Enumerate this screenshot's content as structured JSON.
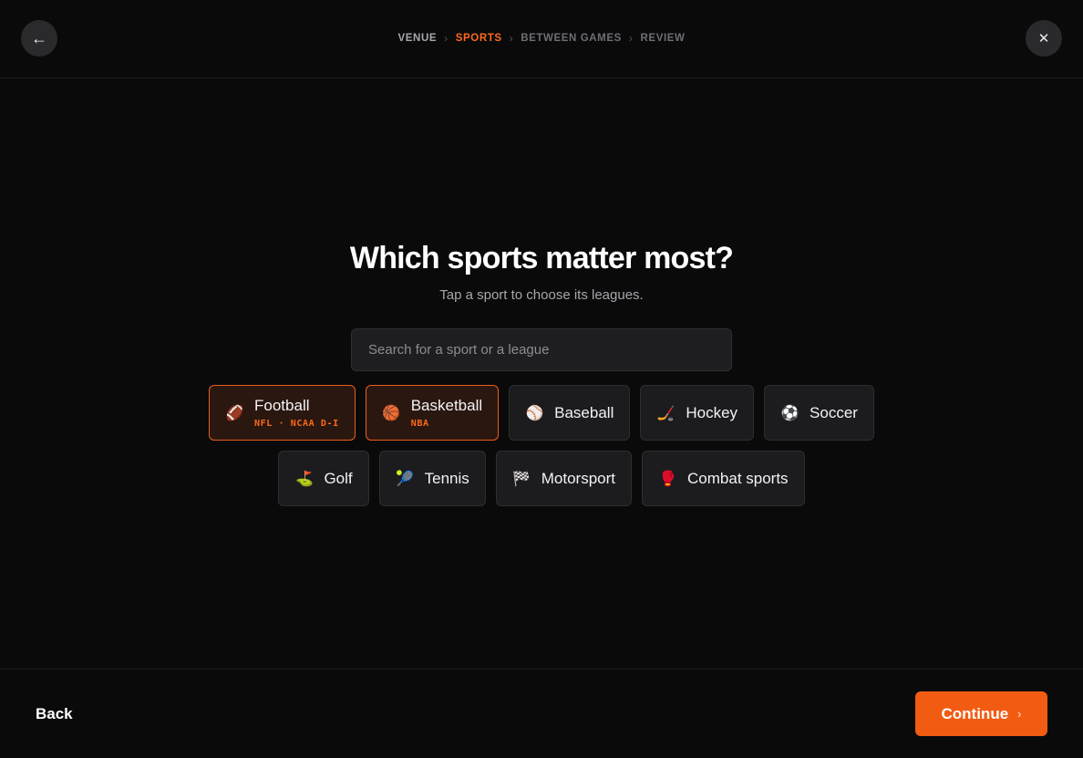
{
  "header": {
    "back_icon": "←",
    "close_icon": "✕",
    "steps": [
      "VENUE",
      "SPORTS",
      "BETWEEN GAMES",
      "REVIEW"
    ],
    "separator": "›",
    "active_step": "SPORTS"
  },
  "main": {
    "title": "Which sports matter most?",
    "subtitle": "Tap a sport to choose its leagues.",
    "search_placeholder": "Search for a sport or a league",
    "sports_row1": [
      {
        "name": "Football",
        "icon": "🏈",
        "icon_name": "american-football-icon",
        "leagues": "NFL · NCAA D-I",
        "selected": true
      },
      {
        "name": "Basketball",
        "icon": "🏀",
        "icon_name": "basketball-icon",
        "leagues": "NBA",
        "selected": true
      },
      {
        "name": "Baseball",
        "icon": "⚾",
        "icon_name": "baseball-icon",
        "leagues": "",
        "selected": false
      },
      {
        "name": "Hockey",
        "icon": "🏒",
        "icon_name": "hockey-stick-icon",
        "leagues": "",
        "selected": false
      },
      {
        "name": "Soccer",
        "icon": "⚽",
        "icon_name": "soccer-ball-icon",
        "leagues": "",
        "selected": false
      }
    ],
    "sports_row2": [
      {
        "name": "Golf",
        "icon": "⛳",
        "icon_name": "golf-flag-icon",
        "leagues": "",
        "selected": false
      },
      {
        "name": "Tennis",
        "icon": "🎾",
        "icon_name": "tennis-ball-icon",
        "leagues": "",
        "selected": false
      },
      {
        "name": "Motorsport",
        "icon": "🏁",
        "icon_name": "checkered-flag-icon",
        "leagues": "",
        "selected": false
      },
      {
        "name": "Combat sports",
        "icon": "🥊",
        "icon_name": "boxing-glove-icon",
        "leagues": "",
        "selected": false
      }
    ]
  },
  "footer": {
    "back_label": "Back",
    "continue_label": "Continue",
    "continue_chevron": "›"
  },
  "colors": {
    "accent": "#f25c12",
    "background": "#0a0a0b",
    "card": "#1c1c1f",
    "selected_card": "#2a1710"
  }
}
